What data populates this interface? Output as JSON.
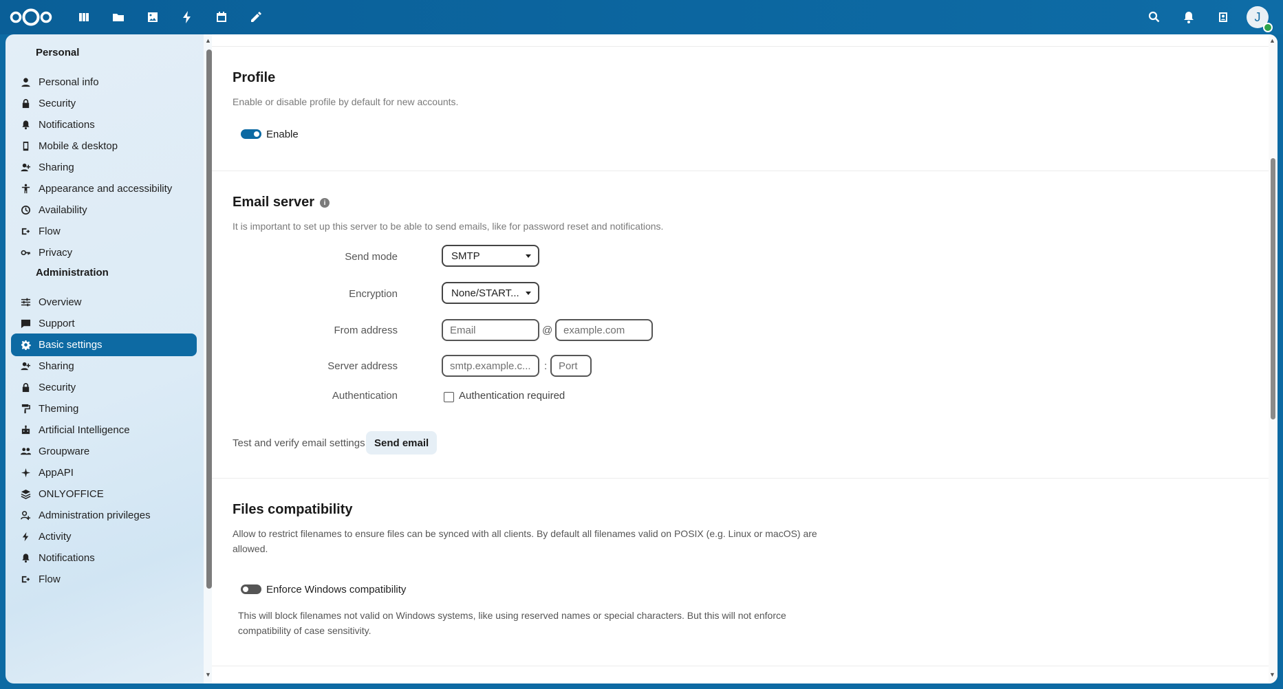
{
  "topbar": {
    "apps": [
      "dashboard-icon",
      "files-icon",
      "photos-icon",
      "activity-icon",
      "calendar-icon",
      "notes-icon"
    ],
    "avatar_initial": "J"
  },
  "sidebar": {
    "personal_heading": "Personal",
    "personal_items": [
      {
        "label": "Personal info",
        "icon": "user-icon"
      },
      {
        "label": "Security",
        "icon": "lock-icon"
      },
      {
        "label": "Notifications",
        "icon": "bell-icon"
      },
      {
        "label": "Mobile & desktop",
        "icon": "phone-icon"
      },
      {
        "label": "Sharing",
        "icon": "share-icon"
      },
      {
        "label": "Appearance and accessibility",
        "icon": "accessibility-icon"
      },
      {
        "label": "Availability",
        "icon": "clock-icon"
      },
      {
        "label": "Flow",
        "icon": "flow-icon"
      },
      {
        "label": "Privacy",
        "icon": "key-icon"
      }
    ],
    "admin_heading": "Administration",
    "admin_items": [
      {
        "label": "Overview",
        "icon": "tune-icon"
      },
      {
        "label": "Support",
        "icon": "chat-icon"
      },
      {
        "label": "Basic settings",
        "icon": "gear-icon",
        "active": true
      },
      {
        "label": "Sharing",
        "icon": "share-icon"
      },
      {
        "label": "Security",
        "icon": "lock-icon"
      },
      {
        "label": "Theming",
        "icon": "paint-roller-icon"
      },
      {
        "label": "Artificial Intelligence",
        "icon": "robot-icon"
      },
      {
        "label": "Groupware",
        "icon": "group-icon"
      },
      {
        "label": "AppAPI",
        "icon": "sparkle-icon"
      },
      {
        "label": "ONLYOFFICE",
        "icon": "layers-icon"
      },
      {
        "label": "Administration privileges",
        "icon": "admin-user-icon"
      },
      {
        "label": "Activity",
        "icon": "bolt-icon"
      },
      {
        "label": "Notifications",
        "icon": "bell-icon"
      },
      {
        "label": "Flow",
        "icon": "flow-icon"
      }
    ]
  },
  "profile": {
    "title": "Profile",
    "description": "Enable or disable profile by default for new accounts.",
    "toggle_label": "Enable",
    "enabled": true
  },
  "email": {
    "title": "Email server",
    "description": "It is important to set up this server to be able to send emails, like for password reset and notifications.",
    "send_mode_label": "Send mode",
    "send_mode_value": "SMTP",
    "encryption_label": "Encryption",
    "encryption_value": "None/START...",
    "from_label": "From address",
    "from_placeholder": "Email",
    "at_sign": "@",
    "domain_placeholder": "example.com",
    "server_label": "Server address",
    "server_placeholder": "smtp.example.c...",
    "colon": ":",
    "port_placeholder": "Port",
    "auth_label": "Authentication",
    "auth_checkbox_label": "Authentication required",
    "test_label": "Test and verify email settings",
    "send_button": "Send email"
  },
  "files": {
    "title": "Files compatibility",
    "description_line1": "Allow to restrict filenames to ensure files can be synced with all clients. By default all filenames valid on POSIX (e.g. Linux or macOS) are",
    "description_line2": "allowed.",
    "toggle_label": "Enforce Windows compatibility",
    "enabled": false,
    "note_line1": "This will block filenames not valid on Windows systems, like using reserved names or special characters. But this will not enforce",
    "note_line2": "compatibility of case sensitivity."
  }
}
